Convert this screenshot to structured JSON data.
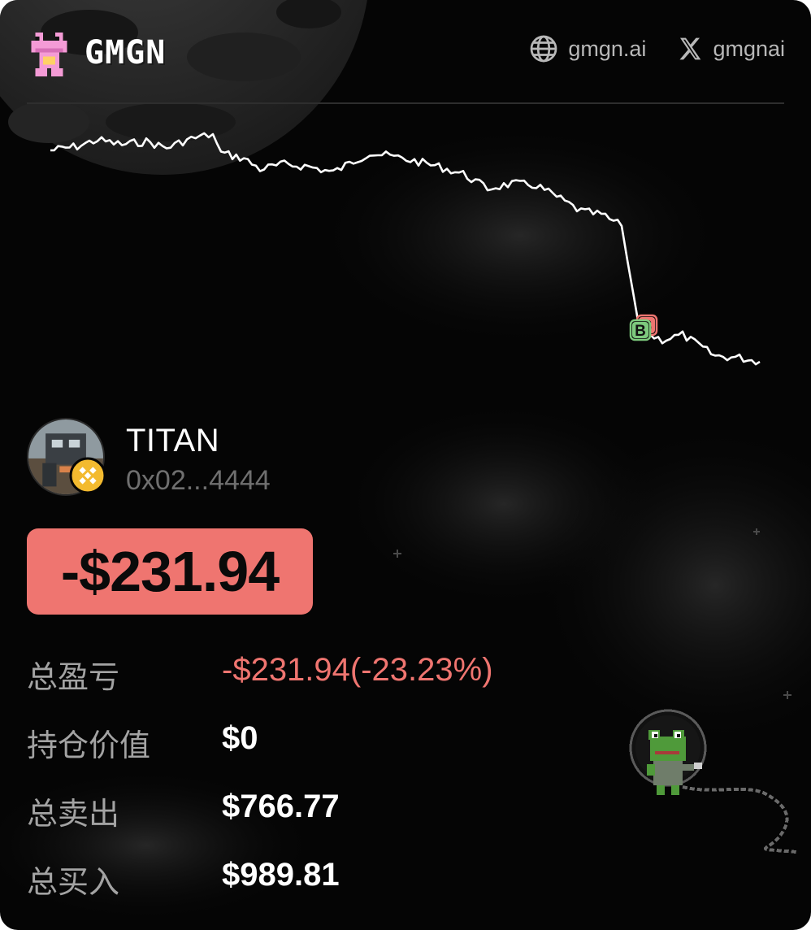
{
  "brand": {
    "name": "GMGN",
    "logo_icon": "pink-frog-logo-icon"
  },
  "links": [
    {
      "icon": "globe-icon",
      "label": "gmgn.ai"
    },
    {
      "icon": "x-logo-icon",
      "label": "gmgnai"
    }
  ],
  "chart": {
    "type": "line",
    "line_color": "#ffffff",
    "markers": [
      {
        "label": "B",
        "color": "#7dc97d"
      },
      {
        "label": "S",
        "color": "#ef7570"
      }
    ]
  },
  "user": {
    "name": "TITAN",
    "address": "0x02...4444",
    "chain_badge": "bnb-chain-icon"
  },
  "pnl": {
    "value": "-$231.94",
    "color": "#ef7570"
  },
  "stats": [
    {
      "label": "总盈亏",
      "value": "-$231.94(-23.23%)",
      "negative": true
    },
    {
      "label": "持仓价值",
      "value": "$0",
      "negative": false
    },
    {
      "label": "总卖出",
      "value": "$766.77",
      "negative": false
    },
    {
      "label": "总买入",
      "value": "$989.81",
      "negative": false
    }
  ],
  "colors": {
    "background": "#050505",
    "negative": "#ef7570",
    "positive": "#7dc97d",
    "muted_text": "#a3a3a3"
  }
}
